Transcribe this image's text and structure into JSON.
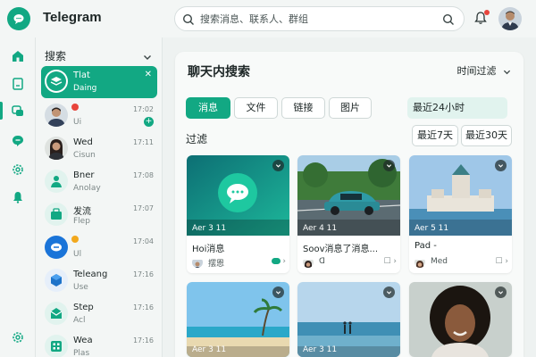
{
  "app": {
    "title": "Telegram"
  },
  "search": {
    "placeholder": "搜索消息、联系人、群组"
  },
  "sidebar": {
    "header": "搜索",
    "chats": [
      {
        "name": "Tlat",
        "preview": "Daing",
        "time": "",
        "active": true
      },
      {
        "name": "",
        "preview": "Ui",
        "time": "17:02",
        "badge": "+"
      },
      {
        "name": "Wed",
        "preview": "Cisun",
        "time": "17:11"
      },
      {
        "name": "Bner",
        "preview": "Anolay",
        "time": "17:08"
      },
      {
        "name": "发流",
        "preview": "Flep",
        "time": "17:07"
      },
      {
        "name": "",
        "preview": "Ul",
        "time": "17:04"
      },
      {
        "name": "Teleang",
        "preview": "Use",
        "time": "17:16"
      },
      {
        "name": "Step",
        "preview": "Acl",
        "time": "17:16"
      },
      {
        "name": "Wea",
        "preview": "Plas",
        "time": "17:16"
      }
    ]
  },
  "panel": {
    "title": "聊天内搜索",
    "time_filter": "时间过滤",
    "tabs": [
      "消息",
      "文件",
      "链接",
      "图片"
    ],
    "recent": "最近24小时",
    "filter_label": "过滤",
    "chips": [
      "最近7天",
      "最近30天"
    ]
  },
  "cards": [
    {
      "meta": "Aer 3 11",
      "title": "Hoi消息",
      "author": "摆恩"
    },
    {
      "meta": "Aer 4 11",
      "title": "Soov消息了消息...",
      "author": "ᗡ"
    },
    {
      "meta": "Aer 5 11",
      "title": "Pad -",
      "author": "Med"
    },
    {
      "meta": "Aer 3 11",
      "title": "",
      "author": ""
    },
    {
      "meta": "Aer 3 11",
      "title": "",
      "author": ""
    },
    {
      "meta": "",
      "title": "",
      "author": ""
    }
  ],
  "colors": {
    "accent": "#12a883",
    "badge_red": "#e8453c"
  }
}
